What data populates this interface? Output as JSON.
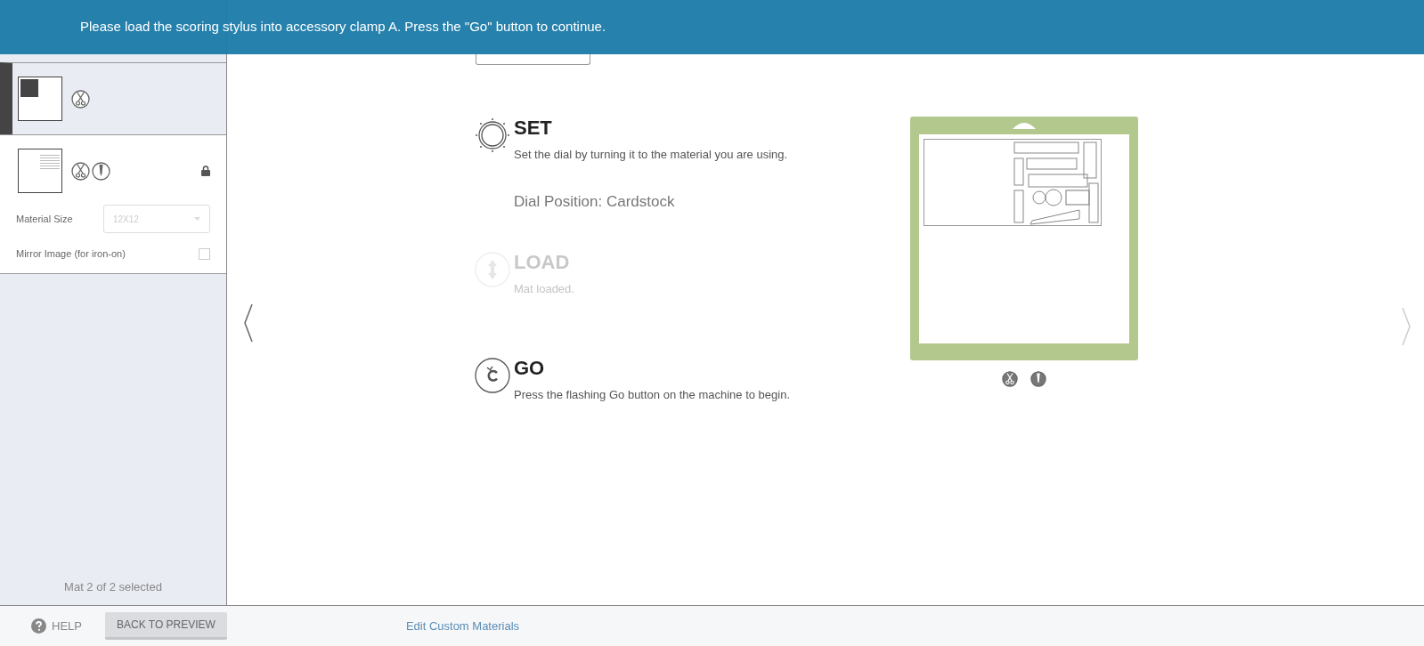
{
  "banner": {
    "message": "Please load the scoring stylus into accessory clamp A. Press the \"Go\" button to continue."
  },
  "mats": [
    {
      "selected": true,
      "locked": false,
      "thumbnail": {
        "kind": "block"
      },
      "tools": [
        {
          "kind": "cut"
        }
      ]
    },
    {
      "selected": false,
      "locked": true,
      "thumbnail": {
        "kind": "design"
      },
      "tools": [
        {
          "kind": "cut"
        },
        {
          "kind": "score"
        }
      ],
      "material_size": {
        "label": "Material Size",
        "placeholder": "12X12",
        "disabled": true
      },
      "mirror": {
        "label": "Mirror Image (for iron-on)",
        "checked": false
      }
    }
  ],
  "sidebar_status": "Mat 2 of 2 selected",
  "steps": [
    {
      "kind": "set",
      "title": "SET",
      "text": "Set the dial by turning it to the material you are using.",
      "disabled": false,
      "detail": "Dial Position: Cardstock"
    },
    {
      "kind": "load",
      "title": "LOAD",
      "text": "Mat loaded.",
      "disabled": true
    },
    {
      "kind": "go",
      "title": "GO",
      "text": "Press the flashing Go button on the machine to begin.",
      "disabled": false
    }
  ],
  "preview": {
    "tools": [
      {
        "kind": "cut"
      },
      {
        "kind": "score"
      }
    ]
  },
  "footer": {
    "help": "HELP",
    "back": "BACK TO PREVIEW",
    "link": "Edit Custom Materials"
  }
}
